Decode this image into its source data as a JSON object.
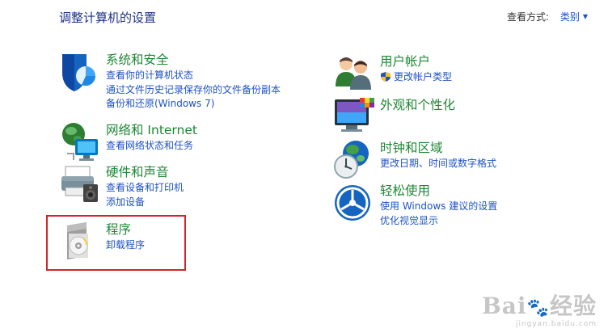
{
  "header": {
    "title": "调整计算机的设置",
    "view_by_label": "查看方式:",
    "view_by_value": "类别"
  },
  "left": [
    {
      "title": "系统和安全",
      "links": [
        "查看你的计算机状态",
        "通过文件历史记录保存你的文件备份副本",
        "备份和还原(Windows 7)"
      ]
    },
    {
      "title": "网络和 Internet",
      "links": [
        "查看网络状态和任务"
      ]
    },
    {
      "title": "硬件和声音",
      "links": [
        "查看设备和打印机",
        "添加设备"
      ]
    },
    {
      "title": "程序",
      "links": [
        "卸载程序"
      ]
    }
  ],
  "right": [
    {
      "title": "用户帐户",
      "links": [
        "更改帐户类型"
      ]
    },
    {
      "title": "外观和个性化",
      "links": []
    },
    {
      "title": "时钟和区域",
      "links": [
        "更改日期、时间或数字格式"
      ]
    },
    {
      "title": "轻松使用",
      "links": [
        "使用 Windows 建议的设置",
        "优化视觉显示"
      ]
    }
  ],
  "watermark": {
    "logo": "Bai  经验",
    "url": "jingyan.baidu.com"
  },
  "colors": {
    "category_title": "#1e8735",
    "link": "#1e52c5",
    "page_title": "#1e3287",
    "highlight": "#d2252a"
  }
}
